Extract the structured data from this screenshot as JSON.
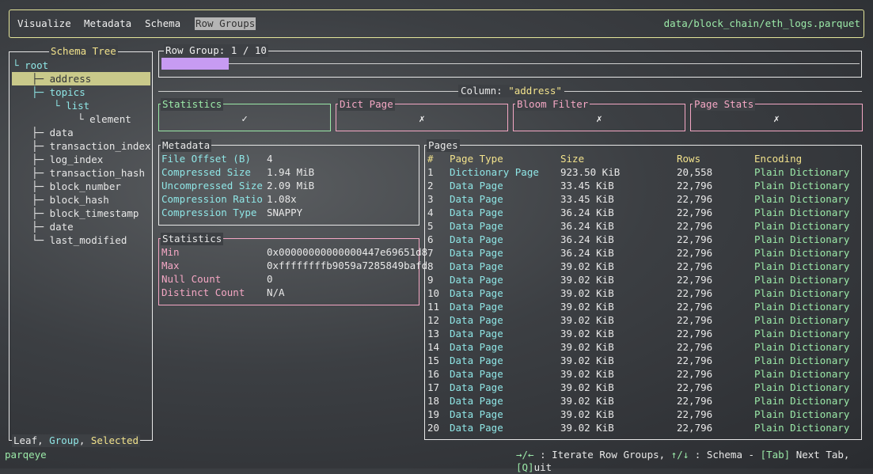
{
  "tabs": [
    "Visualize",
    "Metadata",
    "Schema",
    "Row Groups"
  ],
  "file_path": "data/block_chain/eth_logs.parquet",
  "schema_tree": {
    "title": "Schema Tree",
    "nodes": [
      {
        "label": "root",
        "prefix": "└ ",
        "kind": "group"
      },
      {
        "label": "address",
        "prefix": "├─ ",
        "kind": "selected"
      },
      {
        "label": "topics",
        "prefix": "├─ ",
        "kind": "group"
      },
      {
        "label": "list",
        "prefix": "└ ",
        "kind": "group"
      },
      {
        "label": "element",
        "prefix": "└ ",
        "kind": "leaf"
      },
      {
        "label": "data",
        "prefix": "├─ ",
        "kind": "leaf"
      },
      {
        "label": "transaction_index",
        "prefix": "├─ ",
        "kind": "leaf"
      },
      {
        "label": "log_index",
        "prefix": "├─ ",
        "kind": "leaf"
      },
      {
        "label": "transaction_hash",
        "prefix": "├─ ",
        "kind": "leaf"
      },
      {
        "label": "block_number",
        "prefix": "├─ ",
        "kind": "leaf"
      },
      {
        "label": "block_hash",
        "prefix": "├─ ",
        "kind": "leaf"
      },
      {
        "label": "block_timestamp",
        "prefix": "├─ ",
        "kind": "leaf"
      },
      {
        "label": "date",
        "prefix": "├─ ",
        "kind": "leaf"
      },
      {
        "label": "last_modified",
        "prefix": "└─ ",
        "kind": "leaf"
      }
    ],
    "legend": {
      "leaf": "Leaf",
      "sep1": ", ",
      "group": "Group",
      "sep2": ", ",
      "selected": "Selected"
    }
  },
  "row_group": {
    "title": "Row Group: 1 / 10",
    "progress": 0.1
  },
  "column": {
    "label": "Column: ",
    "name": "\"address\""
  },
  "flags": [
    {
      "title": "Statistics",
      "mark": "✓",
      "color": "#9be9a8"
    },
    {
      "title": "Dict Page",
      "mark": "✗",
      "color": "#f4a7c4"
    },
    {
      "title": "Bloom Filter",
      "mark": "✗",
      "color": "#f4a7c4"
    },
    {
      "title": "Page Stats",
      "mark": "✗",
      "color": "#f4a7c4"
    }
  ],
  "metadata": {
    "title": "Metadata",
    "rows": [
      {
        "key": "File Offset (B)",
        "value": "4"
      },
      {
        "key": "Compressed Size",
        "value": "1.94 MiB"
      },
      {
        "key": "Uncompressed Size",
        "value": "2.09 MiB"
      },
      {
        "key": "Compression Ratio",
        "value": "1.08x"
      },
      {
        "key": "Compression Type",
        "value": "SNAPPY"
      }
    ]
  },
  "statistics": {
    "title": "Statistics",
    "rows": [
      {
        "key": "Min",
        "value": "0x00000000000000447e69651d8"
      },
      {
        "key": "Max",
        "value": "0xffffffffb9059a7285849bafd"
      },
      {
        "key": "Null Count",
        "value": "0"
      },
      {
        "key": "Distinct Count",
        "value": "N/A"
      }
    ]
  },
  "pages": {
    "title": "Pages",
    "headers": [
      "#",
      "Page Type",
      "Size",
      "Rows",
      "Encoding"
    ],
    "rows": [
      [
        "1",
        "Dictionary Page",
        "923.50 KiB",
        "20,558",
        "Plain Dictionary"
      ],
      [
        "2",
        "Data Page",
        "33.45 KiB",
        "22,796",
        "Plain Dictionary"
      ],
      [
        "3",
        "Data Page",
        "33.45 KiB",
        "22,796",
        "Plain Dictionary"
      ],
      [
        "4",
        "Data Page",
        "36.24 KiB",
        "22,796",
        "Plain Dictionary"
      ],
      [
        "5",
        "Data Page",
        "36.24 KiB",
        "22,796",
        "Plain Dictionary"
      ],
      [
        "6",
        "Data Page",
        "36.24 KiB",
        "22,796",
        "Plain Dictionary"
      ],
      [
        "7",
        "Data Page",
        "36.24 KiB",
        "22,796",
        "Plain Dictionary"
      ],
      [
        "8",
        "Data Page",
        "39.02 KiB",
        "22,796",
        "Plain Dictionary"
      ],
      [
        "9",
        "Data Page",
        "39.02 KiB",
        "22,796",
        "Plain Dictionary"
      ],
      [
        "10",
        "Data Page",
        "39.02 KiB",
        "22,796",
        "Plain Dictionary"
      ],
      [
        "11",
        "Data Page",
        "39.02 KiB",
        "22,796",
        "Plain Dictionary"
      ],
      [
        "12",
        "Data Page",
        "39.02 KiB",
        "22,796",
        "Plain Dictionary"
      ],
      [
        "13",
        "Data Page",
        "39.02 KiB",
        "22,796",
        "Plain Dictionary"
      ],
      [
        "14",
        "Data Page",
        "39.02 KiB",
        "22,796",
        "Plain Dictionary"
      ],
      [
        "15",
        "Data Page",
        "39.02 KiB",
        "22,796",
        "Plain Dictionary"
      ],
      [
        "16",
        "Data Page",
        "39.02 KiB",
        "22,796",
        "Plain Dictionary"
      ],
      [
        "17",
        "Data Page",
        "39.02 KiB",
        "22,796",
        "Plain Dictionary"
      ],
      [
        "18",
        "Data Page",
        "39.02 KiB",
        "22,796",
        "Plain Dictionary"
      ],
      [
        "19",
        "Data Page",
        "39.02 KiB",
        "22,796",
        "Plain Dictionary"
      ],
      [
        "20",
        "Data Page",
        "39.02 KiB",
        "22,796",
        "Plain Dictionary"
      ]
    ]
  },
  "status": {
    "app_name": "parqeye",
    "keys_arrows": "→/←",
    "text_iterate": " : Iterate Row Groups, ",
    "keys_updown": "↑/↓",
    "text_schema": " : Schema - ",
    "keys_tab": "[Tab]",
    "text_next": " Next Tab, ",
    "keys_quit": "[Q]",
    "text_quit": "uit"
  }
}
